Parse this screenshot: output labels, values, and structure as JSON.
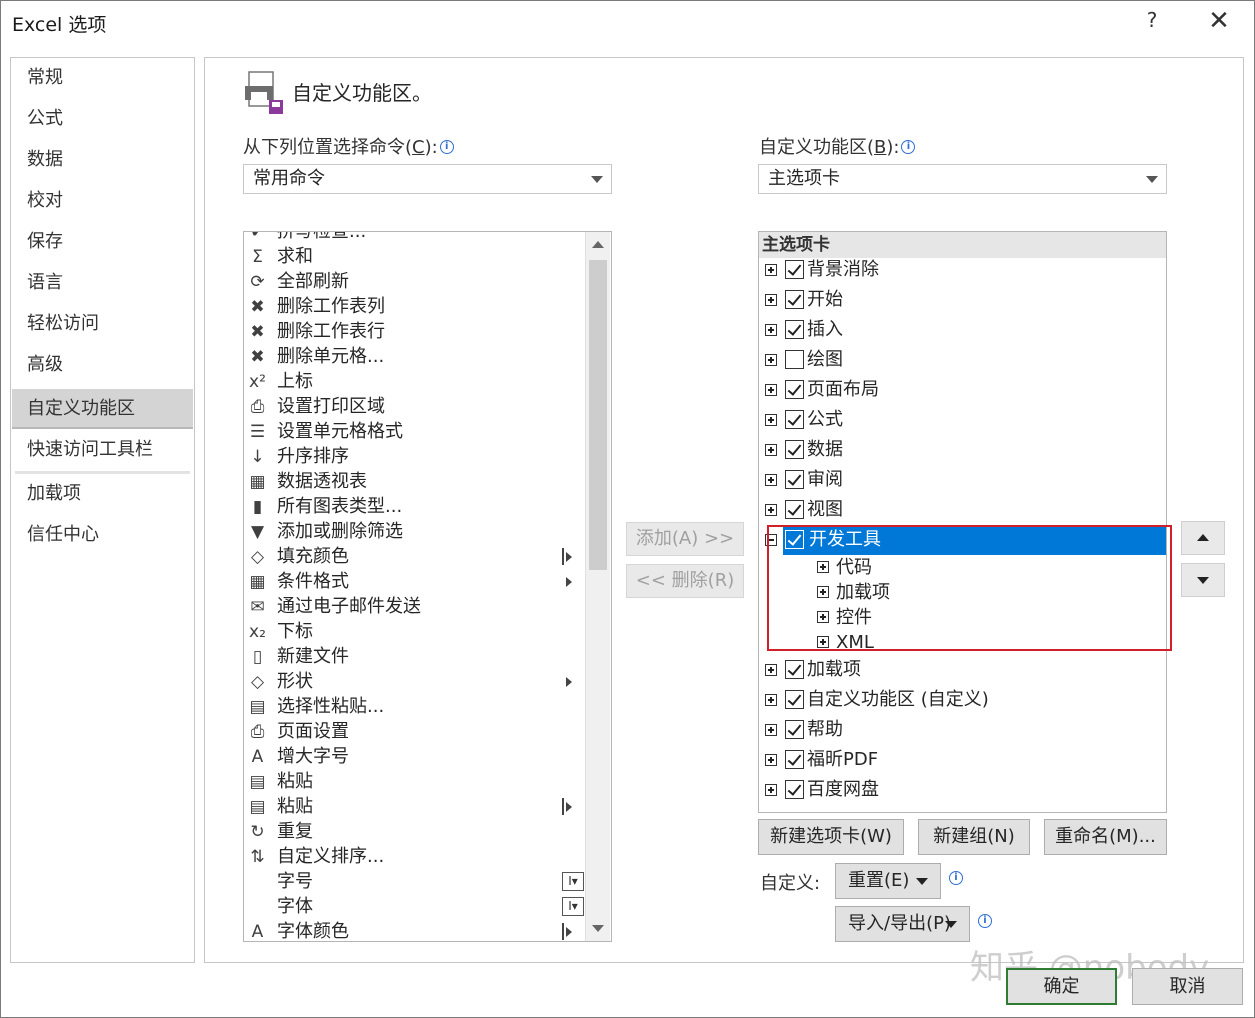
{
  "window": {
    "title": "Excel 选项",
    "help": "?",
    "close": "✕"
  },
  "nav": {
    "items": [
      "常规",
      "公式",
      "数据",
      "校对",
      "保存",
      "语言",
      "轻松访问",
      "高级",
      "自定义功能区",
      "快速访问工具栏",
      "加载项",
      "信任中心"
    ],
    "selected": "自定义功能区"
  },
  "heading": "自定义功能区。",
  "left": {
    "label": "从下列位置选择命令(C):",
    "label_pre": "从下列位置选择命令(",
    "label_key": "C",
    "label_post": "):",
    "combo_value": "常用命令",
    "commands": [
      {
        "icon": "check-icon",
        "glyph": "✔",
        "label": "拼写检查..."
      },
      {
        "icon": "sum-icon",
        "glyph": "Σ",
        "label": "求和"
      },
      {
        "icon": "refresh-all-icon",
        "glyph": "⟳",
        "label": "全部刷新"
      },
      {
        "icon": "delete-columns-icon",
        "glyph": "✖",
        "label": "删除工作表列"
      },
      {
        "icon": "delete-rows-icon",
        "glyph": "✖",
        "label": "删除工作表行"
      },
      {
        "icon": "delete-cells-icon",
        "glyph": "✖",
        "label": "删除单元格..."
      },
      {
        "icon": "superscript-icon",
        "glyph": "x²",
        "label": "上标"
      },
      {
        "icon": "print-area-icon",
        "glyph": "⎙",
        "label": "设置打印区域"
      },
      {
        "icon": "format-cells-icon",
        "glyph": "☰",
        "label": "设置单元格格式"
      },
      {
        "icon": "sort-ascending-icon",
        "glyph": "↓",
        "label": "升序排序"
      },
      {
        "icon": "pivot-table-icon",
        "glyph": "▦",
        "label": "数据透视表"
      },
      {
        "icon": "chart-types-icon",
        "glyph": "▮",
        "label": "所有图表类型..."
      },
      {
        "icon": "filter-icon",
        "glyph": "▼",
        "label": "添加或删除筛选"
      },
      {
        "icon": "fill-color-icon",
        "glyph": "◇",
        "label": "填充颜色",
        "submenu": "bar"
      },
      {
        "icon": "conditional-format-icon",
        "glyph": "▦",
        "label": "条件格式",
        "submenu": "arrow"
      },
      {
        "icon": "email-icon",
        "glyph": "✉",
        "label": "通过电子邮件发送"
      },
      {
        "icon": "subscript-icon",
        "glyph": "x₂",
        "label": "下标"
      },
      {
        "icon": "new-file-icon",
        "glyph": "▯",
        "label": "新建文件"
      },
      {
        "icon": "shapes-icon",
        "glyph": "◇",
        "label": "形状",
        "submenu": "arrow"
      },
      {
        "icon": "paste-special-icon",
        "glyph": "▤",
        "label": "选择性粘贴..."
      },
      {
        "icon": "page-setup-icon",
        "glyph": "⎙",
        "label": "页面设置"
      },
      {
        "icon": "font-grow-icon",
        "glyph": "A",
        "label": "增大字号"
      },
      {
        "icon": "paste-icon",
        "glyph": "▤",
        "label": "粘贴"
      },
      {
        "icon": "paste-icon",
        "glyph": "▤",
        "label": "粘贴",
        "submenu": "bar"
      },
      {
        "icon": "redo-icon",
        "glyph": "↻",
        "label": "重复"
      },
      {
        "icon": "custom-sort-icon",
        "glyph": "⇅",
        "label": "自定义排序..."
      },
      {
        "icon": "font-size-icon",
        "glyph": "",
        "label": "字号",
        "submenu": "box"
      },
      {
        "icon": "font-icon",
        "glyph": "",
        "label": "字体",
        "submenu": "box"
      },
      {
        "icon": "font-color-icon",
        "glyph": "A",
        "label": "字体颜色",
        "submenu": "bar"
      }
    ]
  },
  "middle": {
    "add_label": "添加(A) >>",
    "remove_label": "<< 删除(R)"
  },
  "right": {
    "label_pre": "自定义功能区(",
    "label_key": "B",
    "label_post": "):",
    "combo_value": "主选项卡",
    "tree_header": "主选项卡",
    "tabs_before": [
      {
        "label": "背景消除",
        "checked": true
      },
      {
        "label": "开始",
        "checked": true
      },
      {
        "label": "插入",
        "checked": true
      },
      {
        "label": "绘图",
        "checked": false
      },
      {
        "label": "页面布局",
        "checked": true
      },
      {
        "label": "公式",
        "checked": true
      },
      {
        "label": "数据",
        "checked": true
      },
      {
        "label": "审阅",
        "checked": true
      },
      {
        "label": "视图",
        "checked": true
      }
    ],
    "selected_tab": {
      "label": "开发工具",
      "checked": true
    },
    "groups": [
      "代码",
      "加载项",
      "控件",
      "XML"
    ],
    "tabs_after": [
      {
        "label": "加载项",
        "checked": true
      },
      {
        "label": "自定义功能区 (自定义)",
        "checked": true
      },
      {
        "label": "帮助",
        "checked": true
      },
      {
        "label": "福昕PDF",
        "checked": true
      },
      {
        "label": "百度网盘",
        "checked": true
      }
    ],
    "new_tab_label": "新建选项卡(W)",
    "new_group_label": "新建组(N)",
    "rename_label": "重命名(M)...",
    "customize_label": "自定义:",
    "reset_label": "重置(E)",
    "import_export_label": "导入/导出(P)"
  },
  "footer": {
    "ok_label": "确定",
    "cancel_label": "取消"
  },
  "watermark": "知乎 @nobody",
  "colors": {
    "selection": "#0078d7",
    "highlight_box": "#d0202a",
    "ok_border": "#2e7d32"
  }
}
